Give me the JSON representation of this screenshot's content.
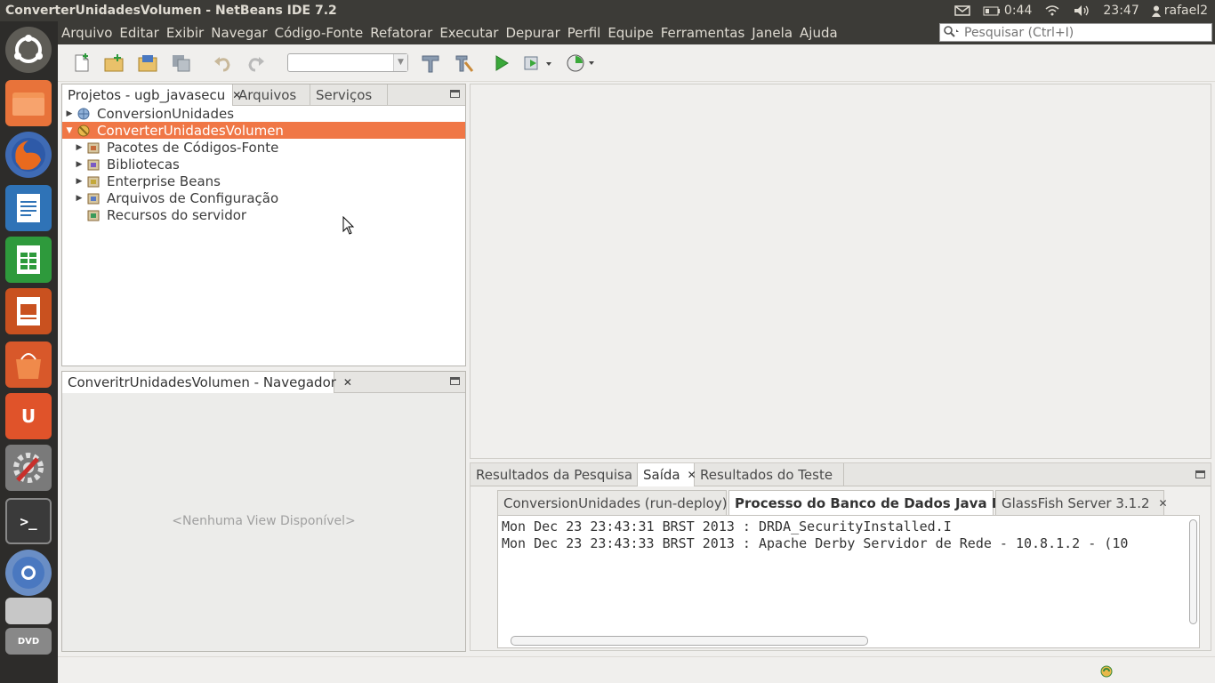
{
  "window": {
    "title": "ConverterUnidadesVolumen - NetBeans IDE 7.2"
  },
  "tray": {
    "battery": "0:44",
    "clock": "23:47",
    "user": "rafael2"
  },
  "menu": [
    "Arquivo",
    "Editar",
    "Exibir",
    "Navegar",
    "Código-Fonte",
    "Refatorar",
    "Executar",
    "Depurar",
    "Perfil",
    "Equipe",
    "Ferramentas",
    "Janela",
    "Ajuda"
  ],
  "search": {
    "placeholder": "Pesquisar (Ctrl+I)"
  },
  "projects_panel": {
    "tabs": [
      {
        "label": "Projetos - ugb_javasecu",
        "closable": true
      },
      {
        "label": "Arquivos"
      },
      {
        "label": "Serviços"
      }
    ],
    "tree": [
      {
        "label": "ConversionUnidades",
        "expanded": false
      },
      {
        "label": "ConverterUnidadesVolumen",
        "expanded": true,
        "selected": true
      },
      {
        "label": "Pacotes de Códigos-Fonte"
      },
      {
        "label": "Bibliotecas"
      },
      {
        "label": "Enterprise Beans"
      },
      {
        "label": "Arquivos de Configuração"
      },
      {
        "label": "Recursos do servidor"
      }
    ]
  },
  "navigator_panel": {
    "tab": "ConveritrUnidadesVolumen - Navegador",
    "empty_text": "<Nenhuma View Disponível>"
  },
  "output_panel": {
    "tabs": [
      "Resultados da Pesquisa",
      "Saída",
      "Resultados do Teste"
    ],
    "sub_tabs": [
      "ConversionUnidades (run-deploy)",
      "Processo do Banco de Dados Java DB",
      "GlassFish Server 3.1.2"
    ],
    "lines": [
      "Mon Dec 23 23:43:31 BRST 2013 : DRDA_SecurityInstalled.I",
      "Mon Dec 23 23:43:33 BRST 2013 : Apache Derby Servidor de Rede - 10.8.1.2 - (10"
    ]
  },
  "colors": {
    "selection": "#f07746",
    "topbar": "#3c3b37",
    "launcher": "#2d2c2a"
  }
}
